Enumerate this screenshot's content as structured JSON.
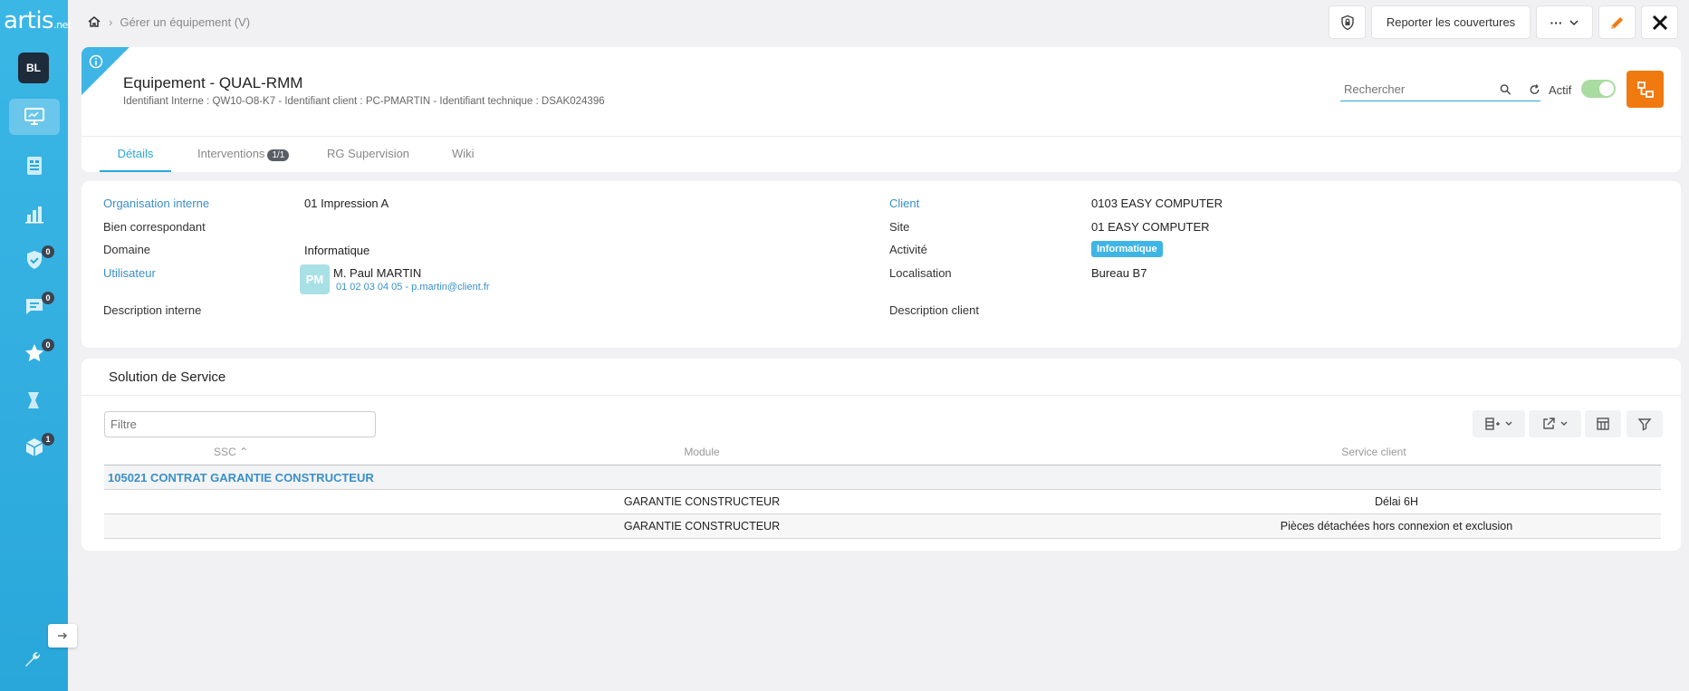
{
  "app": {
    "logo_main": "artis",
    "logo_suffix": ".net",
    "user_initials": "BL"
  },
  "sidebar": {
    "badges": {
      "validation": "0",
      "chat": "0",
      "favorites": "0",
      "packages": "1"
    }
  },
  "breadcrumb": {
    "current": "Gérer un équipement (V)"
  },
  "topbar": {
    "report_label": "Reporter les couvertures",
    "more_label": "···"
  },
  "header": {
    "title": "Equipement - QUAL-RMM",
    "subtitle": "Identifiant Interne : QW10-O8-K7 - Identifiant client : PC-PMARTIN - Identifiant technique : DSAK024396",
    "search_placeholder": "Rechercher",
    "actif_label": "Actif",
    "actif_on": true
  },
  "tabs": [
    {
      "label": "Détails",
      "active": true
    },
    {
      "label": "Interventions",
      "badge": "1/1"
    },
    {
      "label": "RG Supervision"
    },
    {
      "label": "Wiki"
    }
  ],
  "details": {
    "left": [
      {
        "label": "Organisation interne",
        "value": "01 Impression A"
      },
      {
        "label": "Bien correspondant",
        "value": ""
      },
      {
        "label": "Domaine",
        "value": "Informatique"
      },
      {
        "label": "Utilisateur",
        "value": "M. Paul MARTIN",
        "initials": "PM",
        "contact": "01 02 03 04 05 - p.martin@client.fr"
      },
      {
        "label": "Description interne",
        "value": ""
      }
    ],
    "right": [
      {
        "label": "Client",
        "value": "0103 EASY COMPUTER"
      },
      {
        "label": "Site",
        "value": "01 EASY COMPUTER"
      },
      {
        "label": "Activité",
        "value": "Informatique"
      },
      {
        "label": "Localisation",
        "value": "Bureau B7"
      },
      {
        "label": "Description client",
        "value": ""
      }
    ]
  },
  "service": {
    "title": "Solution de Service",
    "filter_placeholder": "Filtre",
    "columns": {
      "ssc": "SSC",
      "module": "Module",
      "service": "Service client"
    },
    "group": "105021 CONTRAT GARANTIE CONSTRUCTEUR",
    "rows": [
      {
        "module": "GARANTIE CONSTRUCTEUR",
        "service": "Délai 6H"
      },
      {
        "module": "GARANTIE CONSTRUCTEUR",
        "service": "Pièces détachées hors connexion et exclusion"
      }
    ]
  }
}
